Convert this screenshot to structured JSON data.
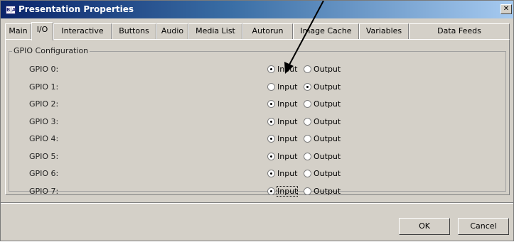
{
  "window": {
    "title": "Presentation Properties",
    "logo_text": "B|A",
    "close_symbol": "✕"
  },
  "tabs": [
    {
      "label": "Main",
      "active": false
    },
    {
      "label": "I/O",
      "active": true
    },
    {
      "label": "Interactive",
      "active": false
    },
    {
      "label": "Buttons",
      "active": false
    },
    {
      "label": "Audio",
      "active": false
    },
    {
      "label": "Media List",
      "active": false
    },
    {
      "label": "Autorun",
      "active": false
    },
    {
      "label": "Image Cache",
      "active": false
    },
    {
      "label": "Variables",
      "active": false
    },
    {
      "label": "Data Feeds",
      "active": false
    }
  ],
  "gpio": {
    "group_title": "GPIO Configuration",
    "input_label": "Input",
    "output_label": "Output",
    "rows": [
      {
        "label": "GPIO 0:",
        "mode": "input"
      },
      {
        "label": "GPIO 1:",
        "mode": "output"
      },
      {
        "label": "GPIO 2:",
        "mode": "input"
      },
      {
        "label": "GPIO 3:",
        "mode": "input"
      },
      {
        "label": "GPIO 4:",
        "mode": "input"
      },
      {
        "label": "GPIO 5:",
        "mode": "input"
      },
      {
        "label": "GPIO 6:",
        "mode": "input"
      },
      {
        "label": "GPIO 7:",
        "mode": "input",
        "focused": true
      }
    ]
  },
  "buttons": {
    "ok": "OK",
    "cancel": "Cancel"
  },
  "icons": {
    "close": "close-icon",
    "logo": "app-logo-icon",
    "annotation": "annotation-arrow"
  }
}
